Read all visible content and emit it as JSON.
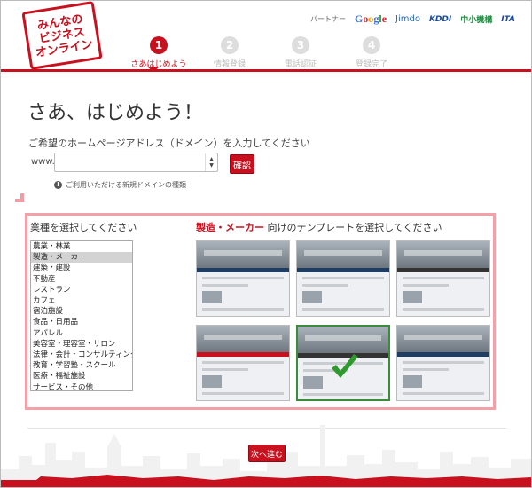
{
  "brand": {
    "logo_text": "みんなの\nビジネス\nオンライン"
  },
  "partners": {
    "label": "パートナー",
    "google": [
      "G",
      "o",
      "o",
      "g",
      "l",
      "e"
    ],
    "jimdo": "Jimdo",
    "kddi": "KDDI",
    "chusho": "中小機構",
    "ita": "ITA"
  },
  "steps": [
    {
      "num": "1",
      "label": "さあはじめよう",
      "active": true
    },
    {
      "num": "2",
      "label": "情報登録",
      "active": false
    },
    {
      "num": "3",
      "label": "電話認証",
      "active": false
    },
    {
      "num": "4",
      "label": "登録完了",
      "active": false
    }
  ],
  "main": {
    "title": "さあ、はじめよう！",
    "subtitle": "ご希望のホームページアドレス（ドメイン）を入力してください",
    "www_label": "www.",
    "domain_value": "",
    "confirm_label": "確認",
    "note": "ご利用いただける新規ドメインの種類"
  },
  "industry": {
    "title": "業種を選択してください",
    "items": [
      "農業・林業",
      "製造・メーカー",
      "建築・建設",
      "不動産",
      "レストラン",
      "カフェ",
      "宿泊施設",
      "食品・日用品",
      "アパレル",
      "美容室・理容室・サロン",
      "法律・会計・コンサルティング",
      "教育・学習塾・スクール",
      "医療・福祉施設",
      "サービス・その他"
    ],
    "selected_index": 1
  },
  "templates": {
    "title_highlight": "製造・メーカー",
    "title_rest": " 向けのテンプレートを選択してください",
    "items": [
      {
        "style": "blue",
        "selected": false
      },
      {
        "style": "blue",
        "selected": false
      },
      {
        "style": "dark",
        "selected": false
      },
      {
        "style": "red",
        "selected": false
      },
      {
        "style": "dark",
        "selected": true
      },
      {
        "style": "blue",
        "selected": false
      }
    ]
  },
  "footer": {
    "next_label": "次へ進む"
  },
  "colors": {
    "accent": "#c8101e",
    "selection_box": "#f3a0a8",
    "check": "#2e9a2e"
  }
}
